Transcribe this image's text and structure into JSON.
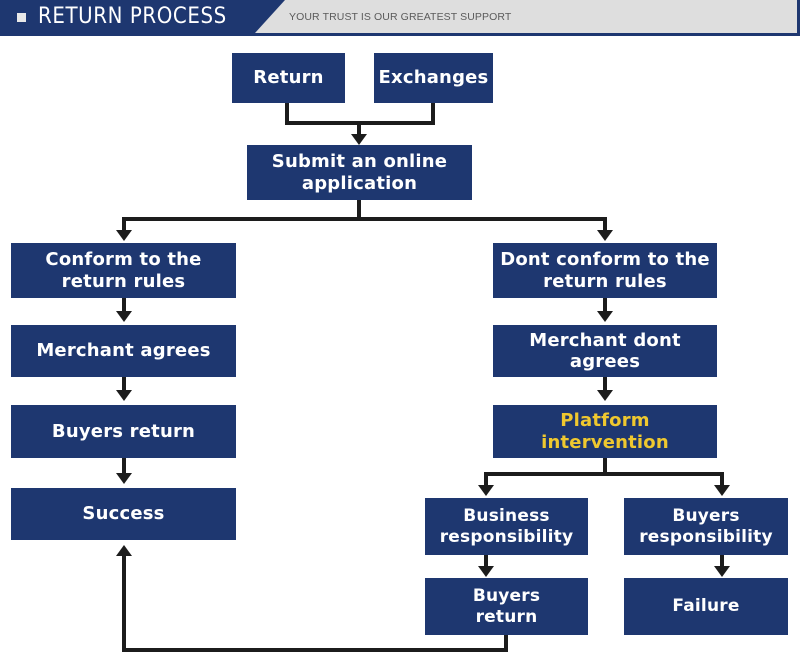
{
  "header": {
    "title": "RETURN PROCESS",
    "tagline": "YOUR TRUST IS OUR GREATEST SUPPORT",
    "bullet_icon": "square-bullet-icon",
    "tab_color": "#1e3770",
    "bar_color": "#dedede"
  },
  "theme": {
    "box_fill": "#1e3770",
    "box_text": "#ffffff",
    "accent_text": "#efc82f",
    "connector": "#1c1c1c",
    "page_background": "#ffffff"
  },
  "flow": {
    "nodes": [
      {
        "id": "return",
        "label": "Return",
        "accent": false
      },
      {
        "id": "exchanges",
        "label": "Exchanges",
        "accent": false
      },
      {
        "id": "submit-application",
        "label": "Submit an online\napplication",
        "accent": false
      },
      {
        "id": "conform-rules",
        "label": "Conform to the\nreturn rules",
        "accent": false
      },
      {
        "id": "dont-conform-rules",
        "label": "Dont conform to the\nreturn rules",
        "accent": false
      },
      {
        "id": "merchant-agrees",
        "label": "Merchant agrees",
        "accent": false
      },
      {
        "id": "merchant-dont-agrees",
        "label": "Merchant dont agrees",
        "accent": false
      },
      {
        "id": "buyers-return-left",
        "label": "Buyers return",
        "accent": false
      },
      {
        "id": "platform-intervention",
        "label": "Platform\nintervention",
        "accent": true
      },
      {
        "id": "success",
        "label": "Success",
        "accent": false
      },
      {
        "id": "business-responsibility",
        "label": "Business\nresponsibility",
        "accent": false
      },
      {
        "id": "buyers-responsibility",
        "label": "Buyers\nresponsibility",
        "accent": false
      },
      {
        "id": "buyers-return-bottom",
        "label": "Buyers\nreturn",
        "accent": false
      },
      {
        "id": "failure",
        "label": "Failure",
        "accent": false
      }
    ],
    "edges": [
      {
        "from": "return",
        "to": "submit-application"
      },
      {
        "from": "exchanges",
        "to": "submit-application"
      },
      {
        "from": "submit-application",
        "to": "conform-rules"
      },
      {
        "from": "submit-application",
        "to": "dont-conform-rules"
      },
      {
        "from": "conform-rules",
        "to": "merchant-agrees"
      },
      {
        "from": "merchant-agrees",
        "to": "buyers-return-left"
      },
      {
        "from": "buyers-return-left",
        "to": "success"
      },
      {
        "from": "dont-conform-rules",
        "to": "merchant-dont-agrees"
      },
      {
        "from": "merchant-dont-agrees",
        "to": "platform-intervention"
      },
      {
        "from": "platform-intervention",
        "to": "business-responsibility"
      },
      {
        "from": "platform-intervention",
        "to": "buyers-responsibility"
      },
      {
        "from": "business-responsibility",
        "to": "buyers-return-bottom"
      },
      {
        "from": "buyers-responsibility",
        "to": "failure"
      },
      {
        "from": "buyers-return-bottom",
        "to": "success"
      }
    ]
  }
}
